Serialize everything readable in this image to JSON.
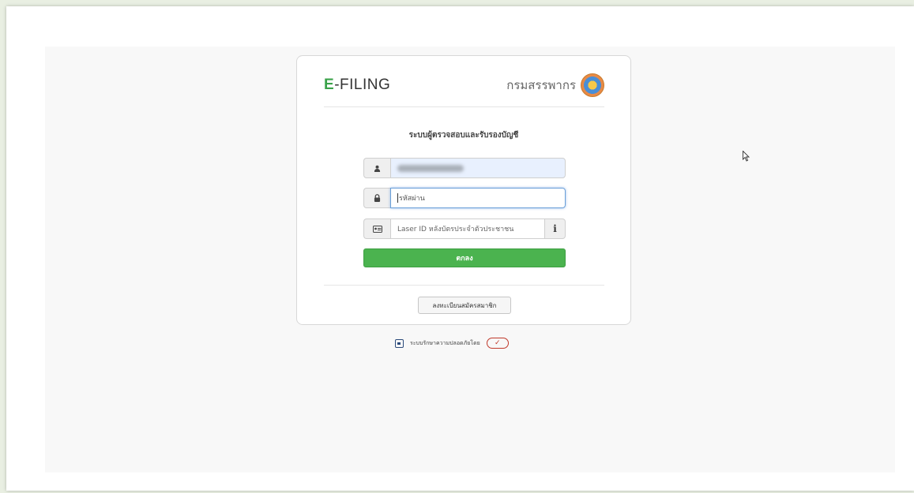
{
  "brand": {
    "logo_e": "E",
    "logo_rest": "-FILING",
    "department": "กรมสรรพากร",
    "seal_icon": "rd-seal-icon"
  },
  "form": {
    "title": "ระบบผู้ตรวจสอบและรับรองบัญชี",
    "user_icon": "user-icon",
    "lock_icon": "lock-icon",
    "id_card_icon": "id-card-icon",
    "info_icon": "info-icon",
    "password_placeholder": "รหัสผ่าน",
    "laser_placeholder": "Laser ID หลังบัตรประจำตัวประชาชน",
    "info_label": "i",
    "submit_label": "ตกลง",
    "register_label": "ลงทะเบียนสมัครสมาชิก"
  },
  "footer": {
    "security_text": "ระบบรักษาความปลอดภัยโดย",
    "etda_label": "✓"
  },
  "colors": {
    "accent_green": "#4bb34f",
    "focus_blue": "#6a9fd8",
    "autofill_blue": "#e8f0fe"
  }
}
